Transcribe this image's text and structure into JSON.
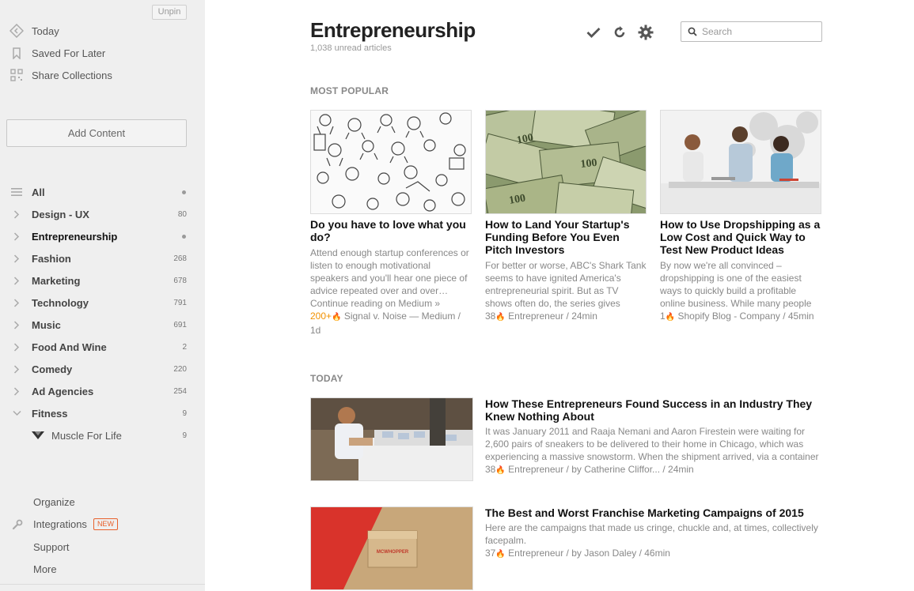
{
  "sidebar": {
    "unpin_label": "Unpin",
    "nav": [
      {
        "label": "Today",
        "icon": "today-icon"
      },
      {
        "label": "Saved For Later",
        "icon": "bookmark-icon"
      },
      {
        "label": "Share Collections",
        "icon": "collections-icon"
      }
    ],
    "add_content_label": "Add Content",
    "feeds": [
      {
        "label": "All",
        "count": "",
        "dot": true,
        "icon": "list-icon"
      },
      {
        "label": "Design - UX",
        "count": "80"
      },
      {
        "label": "Entrepreneurship",
        "count": "",
        "dot": true,
        "active": true
      },
      {
        "label": "Fashion",
        "count": "268"
      },
      {
        "label": "Marketing",
        "count": "678"
      },
      {
        "label": "Technology",
        "count": "791"
      },
      {
        "label": "Music",
        "count": "691"
      },
      {
        "label": "Food And Wine",
        "count": "2"
      },
      {
        "label": "Comedy",
        "count": "220"
      },
      {
        "label": "Ad Agencies",
        "count": "254"
      },
      {
        "label": "Fitness",
        "count": "9",
        "expanded": true
      }
    ],
    "subfeed": {
      "label": "Muscle For Life",
      "count": "9"
    },
    "bottom": {
      "organize": "Organize",
      "integrations": "Integrations",
      "new_badge": "NEW",
      "support": "Support",
      "more": "More"
    }
  },
  "header": {
    "title": "Entrepreneurship",
    "unread": "1,038 unread articles",
    "search_placeholder": "Search"
  },
  "sections": {
    "popular": "MOST POPULAR",
    "today": "TODAY"
  },
  "popular": [
    {
      "title": "Do you have to love what you do?",
      "summary": "Attend enough startup conferences or listen to enough motivational speakers and you'll hear one piece of advice repeated over and over…",
      "extra": "Continue reading on Medium »",
      "count": "200+",
      "hot": true,
      "source": "Signal v. Noise — Medium / 1d"
    },
    {
      "title": "How to Land Your Startup's Funding Before You Even Pitch Investors",
      "summary": "For better or worse, ABC's Shark Tank seems to have ignited America's entrepreneurial spirit. But as TV shows often do, the series gives",
      "count": "38",
      "source": "Entrepreneur / 24min"
    },
    {
      "title": "How to Use Dropshipping as a Low Cost and Quick Way to Test New Product Ideas",
      "summary": "By now we're all convinced – dropshipping is one of the easiest ways to quickly build a profitable online business. While many people",
      "count": "1",
      "source": "Shopify Blog - Company / 45min"
    }
  ],
  "today": [
    {
      "title": "How These Entrepreneurs Found Success in an Industry They Knew Nothing About",
      "summary": "It was January 2011 and Raaja Nemani and Aaron Firestein were waiting for 2,600 pairs of sneakers to be delivered to their home in Chicago, which was experiencing a massive snowstorm. When the shipment arrived, via a container",
      "count": "38",
      "source": "Entrepreneur / by Catherine Cliffor... / 24min"
    },
    {
      "title": "The Best and Worst Franchise Marketing Campaigns of 2015",
      "summary": "Here are the campaigns that made us cringe, chuckle and, at times, collectively facepalm.",
      "count": "37",
      "source": "Entrepreneur / by Jason Daley / 46min",
      "thumb_text": "MCWHOPPER"
    }
  ],
  "colors": {
    "accent_orange": "#e8612c",
    "hot": "#f29100",
    "sidebar_bg": "#efefef"
  }
}
